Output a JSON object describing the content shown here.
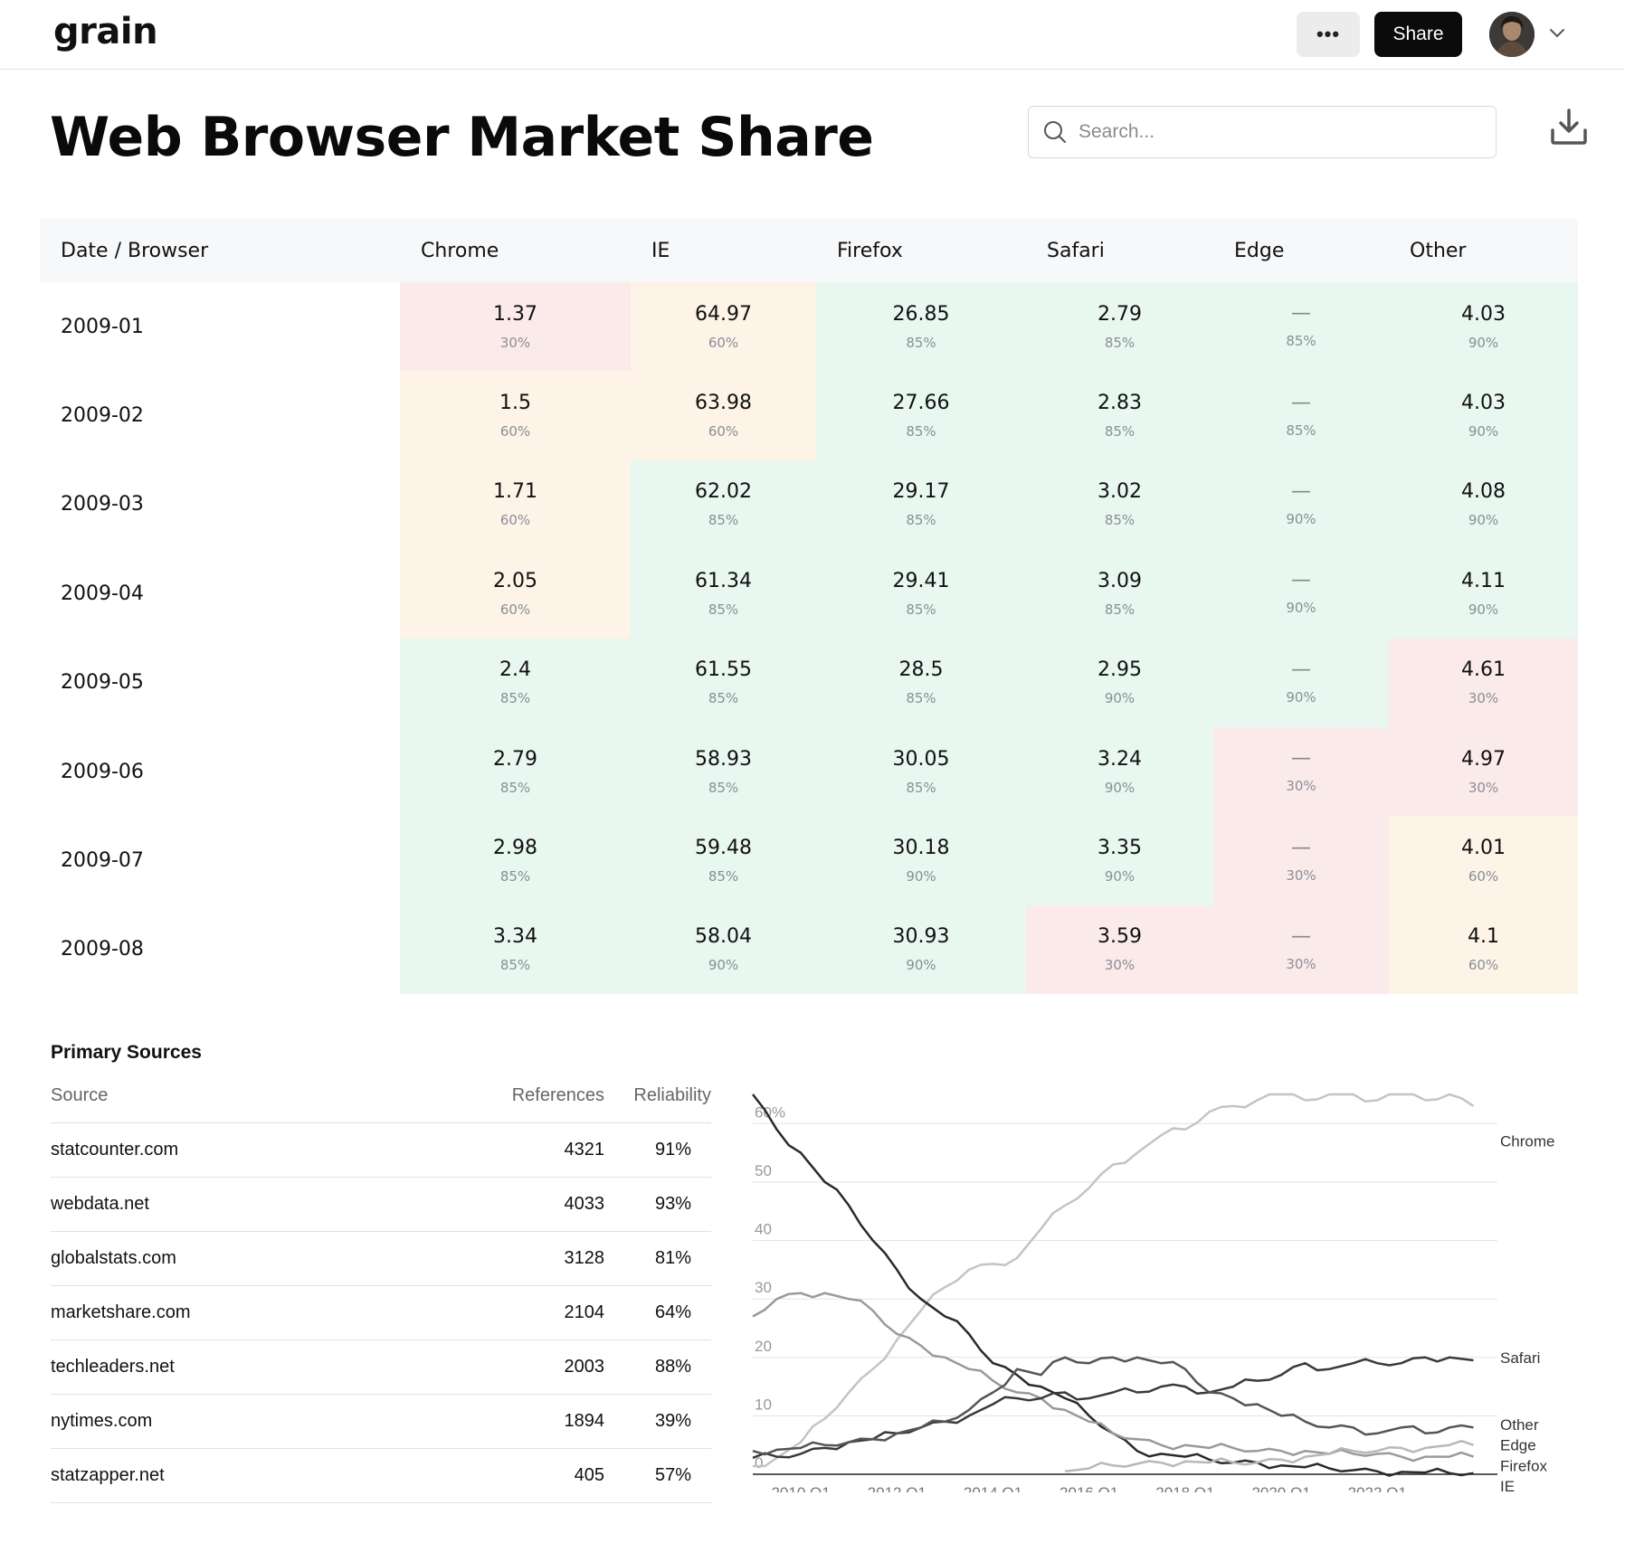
{
  "app": {
    "logo": "grain"
  },
  "header": {
    "more_label": "•••",
    "share_label": "Share"
  },
  "page": {
    "title": "Web Browser Market Share"
  },
  "search": {
    "placeholder": "Search..."
  },
  "table": {
    "columns": [
      "Date / Browser",
      "Chrome",
      "IE",
      "Firefox",
      "Safari",
      "Edge",
      "Other"
    ],
    "rows": [
      {
        "date": "2009-01",
        "cells": [
          {
            "value": "1.37",
            "pct": "30%",
            "color": "red"
          },
          {
            "value": "64.97",
            "pct": "60%",
            "color": "orange"
          },
          {
            "value": "26.85",
            "pct": "85%",
            "color": "green"
          },
          {
            "value": "2.79",
            "pct": "85%",
            "color": "green"
          },
          {
            "value": "—",
            "pct": "85%",
            "color": "green"
          },
          {
            "value": "4.03",
            "pct": "90%",
            "color": "green"
          }
        ]
      },
      {
        "date": "2009-02",
        "cells": [
          {
            "value": "1.5",
            "pct": "60%",
            "color": "orange"
          },
          {
            "value": "63.98",
            "pct": "60%",
            "color": "orange"
          },
          {
            "value": "27.66",
            "pct": "85%",
            "color": "green"
          },
          {
            "value": "2.83",
            "pct": "85%",
            "color": "green"
          },
          {
            "value": "—",
            "pct": "85%",
            "color": "green"
          },
          {
            "value": "4.03",
            "pct": "90%",
            "color": "green"
          }
        ]
      },
      {
        "date": "2009-03",
        "cells": [
          {
            "value": "1.71",
            "pct": "60%",
            "color": "orange"
          },
          {
            "value": "62.02",
            "pct": "85%",
            "color": "green"
          },
          {
            "value": "29.17",
            "pct": "85%",
            "color": "green"
          },
          {
            "value": "3.02",
            "pct": "85%",
            "color": "green"
          },
          {
            "value": "—",
            "pct": "90%",
            "color": "green"
          },
          {
            "value": "4.08",
            "pct": "90%",
            "color": "green"
          }
        ]
      },
      {
        "date": "2009-04",
        "cells": [
          {
            "value": "2.05",
            "pct": "60%",
            "color": "orange"
          },
          {
            "value": "61.34",
            "pct": "85%",
            "color": "green"
          },
          {
            "value": "29.41",
            "pct": "85%",
            "color": "green"
          },
          {
            "value": "3.09",
            "pct": "85%",
            "color": "green"
          },
          {
            "value": "—",
            "pct": "90%",
            "color": "green"
          },
          {
            "value": "4.11",
            "pct": "90%",
            "color": "green"
          }
        ]
      },
      {
        "date": "2009-05",
        "cells": [
          {
            "value": "2.4",
            "pct": "85%",
            "color": "green"
          },
          {
            "value": "61.55",
            "pct": "85%",
            "color": "green"
          },
          {
            "value": "28.5",
            "pct": "85%",
            "color": "green"
          },
          {
            "value": "2.95",
            "pct": "90%",
            "color": "green"
          },
          {
            "value": "—",
            "pct": "90%",
            "color": "green"
          },
          {
            "value": "4.61",
            "pct": "30%",
            "color": "red"
          }
        ]
      },
      {
        "date": "2009-06",
        "cells": [
          {
            "value": "2.79",
            "pct": "85%",
            "color": "green"
          },
          {
            "value": "58.93",
            "pct": "85%",
            "color": "green"
          },
          {
            "value": "30.05",
            "pct": "85%",
            "color": "green"
          },
          {
            "value": "3.24",
            "pct": "90%",
            "color": "green"
          },
          {
            "value": "—",
            "pct": "30%",
            "color": "red"
          },
          {
            "value": "4.97",
            "pct": "30%",
            "color": "red"
          }
        ]
      },
      {
        "date": "2009-07",
        "cells": [
          {
            "value": "2.98",
            "pct": "85%",
            "color": "green"
          },
          {
            "value": "59.48",
            "pct": "85%",
            "color": "green"
          },
          {
            "value": "30.18",
            "pct": "90%",
            "color": "green"
          },
          {
            "value": "3.35",
            "pct": "90%",
            "color": "green"
          },
          {
            "value": "—",
            "pct": "30%",
            "color": "red"
          },
          {
            "value": "4.01",
            "pct": "60%",
            "color": "orange"
          }
        ]
      },
      {
        "date": "2009-08",
        "cells": [
          {
            "value": "3.34",
            "pct": "85%",
            "color": "green"
          },
          {
            "value": "58.04",
            "pct": "90%",
            "color": "green"
          },
          {
            "value": "30.93",
            "pct": "90%",
            "color": "green"
          },
          {
            "value": "3.59",
            "pct": "30%",
            "color": "red"
          },
          {
            "value": "—",
            "pct": "30%",
            "color": "red"
          },
          {
            "value": "4.1",
            "pct": "60%",
            "color": "orange"
          }
        ]
      }
    ]
  },
  "colors": {
    "green": "#e8f7ef",
    "red": "#fbeaea",
    "orange": "#fdf3e7"
  },
  "sources": {
    "title": "Primary Sources",
    "columns": [
      "Source",
      "References",
      "Reliability"
    ],
    "rows": [
      {
        "source": "statcounter.com",
        "refs": "4321",
        "rel": "91%"
      },
      {
        "source": "webdata.net",
        "refs": "4033",
        "rel": "93%"
      },
      {
        "source": "globalstats.com",
        "refs": "3128",
        "rel": "81%"
      },
      {
        "source": "marketshare.com",
        "refs": "2104",
        "rel": "64%"
      },
      {
        "source": "techleaders.net",
        "refs": "2003",
        "rel": "88%"
      },
      {
        "source": "nytimes.com",
        "refs": "1894",
        "rel": "39%"
      },
      {
        "source": "statzapper.net",
        "refs": "405",
        "rel": "57%"
      }
    ]
  },
  "chart_data": {
    "type": "line",
    "title": "",
    "xlabel": "",
    "ylabel": "",
    "x_ticks": [
      "2010 Q1",
      "2012 Q1",
      "2014 Q1",
      "2016 Q1",
      "2018 Q1",
      "2020 Q1",
      "2022 Q1"
    ],
    "y_ticks": [
      "0",
      "10",
      "20",
      "30",
      "40",
      "50",
      "60%"
    ],
    "xlim": [
      2009.0,
      2024.5
    ],
    "ylim": [
      0,
      65
    ],
    "grid": true,
    "legend": "direct labels at right end",
    "series": [
      {
        "name": "Chrome",
        "color": "#c4c4c4",
        "x": [
          2009.0,
          2009.5,
          2010.0,
          2010.5,
          2011.0,
          2011.5,
          2012.0,
          2012.5,
          2013.0,
          2013.5,
          2014.0,
          2014.5,
          2015.0,
          2015.5,
          2016.0,
          2016.5,
          2017.0,
          2017.5,
          2018.0,
          2018.5,
          2019.0,
          2019.5,
          2020.0,
          2020.5,
          2021.0,
          2021.5,
          2022.0,
          2022.5,
          2023.0,
          2023.5,
          2024.0
        ],
        "y": [
          1.4,
          2.8,
          5.5,
          9.5,
          14,
          18,
          23,
          28,
          32,
          35,
          36,
          37,
          42,
          46,
          49,
          53,
          55,
          58,
          59,
          62,
          63,
          64,
          66,
          64,
          65,
          65,
          64,
          66,
          64,
          65,
          63
        ]
      },
      {
        "name": "IE",
        "color": "#2a2a2a",
        "x": [
          2009.0,
          2009.5,
          2010.0,
          2010.5,
          2011.0,
          2011.5,
          2012.0,
          2012.5,
          2013.0,
          2013.5,
          2014.0,
          2014.5,
          2015.0,
          2015.5,
          2016.0,
          2016.5,
          2017.0,
          2017.5,
          2018.0,
          2018.5,
          2019.0,
          2019.5,
          2020.0,
          2020.5,
          2021.0,
          2021.5,
          2022.0,
          2022.5,
          2023.0,
          2023.5,
          2024.0
        ],
        "y": [
          65,
          59,
          55,
          50,
          46,
          40,
          35,
          30,
          27,
          24,
          19,
          17,
          15,
          13,
          10,
          7,
          4,
          3.5,
          3,
          2.5,
          2,
          2,
          1.5,
          1.2,
          1,
          0.7,
          0.5,
          0.4,
          0.3,
          0.2,
          0.2
        ]
      },
      {
        "name": "Firefox",
        "color": "#9a9a9a",
        "x": [
          2009.0,
          2009.5,
          2010.0,
          2010.5,
          2011.0,
          2011.5,
          2012.0,
          2012.5,
          2013.0,
          2013.5,
          2014.0,
          2014.5,
          2015.0,
          2015.5,
          2016.0,
          2016.5,
          2017.0,
          2017.5,
          2018.0,
          2018.5,
          2019.0,
          2019.5,
          2020.0,
          2020.5,
          2021.0,
          2021.5,
          2022.0,
          2022.5,
          2023.0,
          2023.5,
          2024.0
        ],
        "y": [
          27,
          30,
          31,
          31,
          30,
          28,
          24,
          22,
          20,
          18,
          16,
          14,
          13,
          11,
          9,
          7,
          6,
          5,
          5,
          4.5,
          4.5,
          4,
          4,
          4,
          3.5,
          3.5,
          3.5,
          3,
          3,
          3,
          3
        ]
      },
      {
        "name": "Safari",
        "color": "#3a3a3a",
        "x": [
          2009.0,
          2009.5,
          2010.0,
          2010.5,
          2011.0,
          2011.5,
          2012.0,
          2012.5,
          2013.0,
          2013.5,
          2014.0,
          2014.5,
          2015.0,
          2015.5,
          2016.0,
          2016.5,
          2017.0,
          2017.5,
          2018.0,
          2018.5,
          2019.0,
          2019.5,
          2020.0,
          2020.5,
          2021.0,
          2021.5,
          2022.0,
          2022.5,
          2023.0,
          2023.5,
          2024.0
        ],
        "y": [
          2.8,
          3,
          3.5,
          4.5,
          5.5,
          6,
          7,
          8,
          9,
          10,
          12,
          13,
          13,
          14,
          13,
          14,
          14,
          15,
          15,
          14,
          15,
          16,
          17,
          19,
          18,
          19,
          19,
          19,
          20,
          20,
          19.5
        ]
      },
      {
        "name": "Edge",
        "color": "#b8b8b8",
        "x": [
          2015.5,
          2016.0,
          2016.5,
          2017.0,
          2017.5,
          2018.0,
          2018.5,
          2019.0,
          2019.5,
          2020.0,
          2020.5,
          2021.0,
          2021.5,
          2022.0,
          2022.5,
          2023.0,
          2023.5,
          2024.0
        ],
        "y": [
          0.5,
          1,
          1.5,
          1.8,
          2,
          2.2,
          2,
          2,
          2,
          2.5,
          3,
          3.5,
          4,
          4,
          4.5,
          4.5,
          5,
          5
        ]
      },
      {
        "name": "Other",
        "color": "#555555",
        "x": [
          2009.0,
          2009.5,
          2010.0,
          2010.5,
          2011.0,
          2011.5,
          2012.0,
          2012.5,
          2013.0,
          2013.5,
          2014.0,
          2014.5,
          2015.0,
          2015.5,
          2016.0,
          2016.5,
          2017.0,
          2017.5,
          2018.0,
          2018.5,
          2019.0,
          2019.5,
          2020.0,
          2020.5,
          2021.0,
          2021.5,
          2022.0,
          2022.5,
          2023.0,
          2023.5,
          2024.0
        ],
        "y": [
          4,
          4.2,
          4.5,
          5,
          5.5,
          6,
          7,
          8,
          9,
          11,
          14,
          18,
          17,
          20,
          19,
          20,
          20,
          19,
          18,
          14,
          13,
          12,
          10,
          9,
          8,
          8,
          7,
          8,
          7,
          8,
          8
        ]
      }
    ]
  }
}
